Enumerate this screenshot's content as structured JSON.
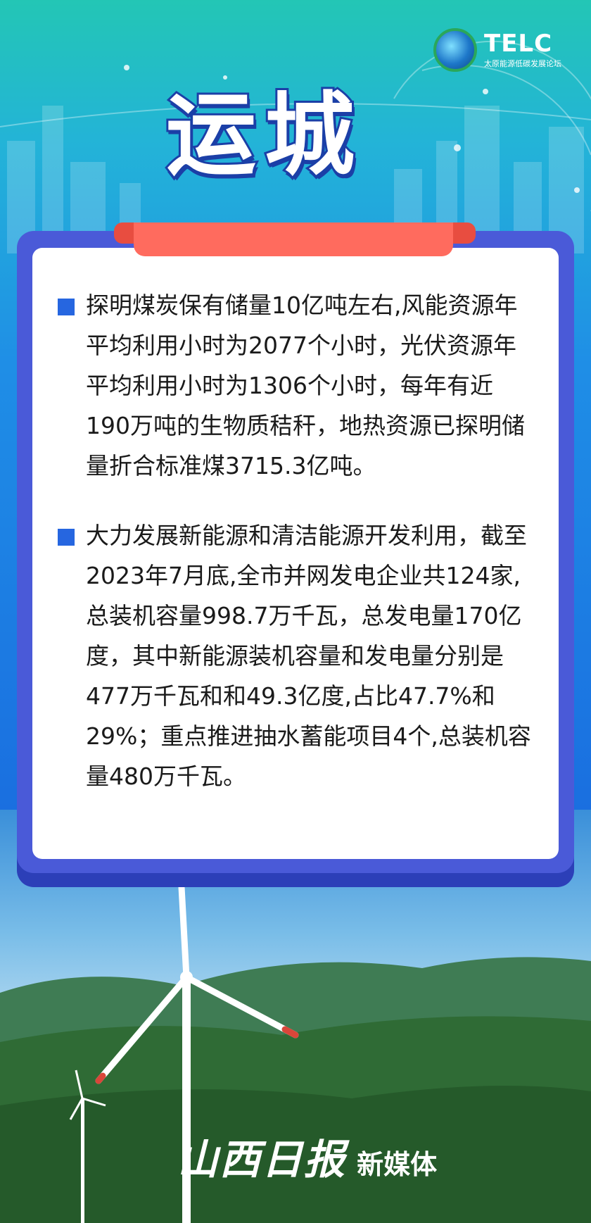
{
  "logo": {
    "name": "TELC",
    "subtitle": "太原能源低碳发展论坛"
  },
  "city_title": "运城",
  "paragraphs": [
    "探明煤炭保有储量10亿吨左右,风能资源年平均利用小时为2077个小时，光伏资源年平均利用小时为1306个小时，每年有近190万吨的生物质秸秆，地热资源已探明储量折合标准煤3715.3亿吨。",
    "大力发展新能源和清洁能源开发利用，截至2023年7月底,全市并网发电企业共124家,总装机容量998.7万千瓦，总发电量170亿度，其中新能源装机容量和发电量分别是477万千瓦和和49.3亿度,占比47.7%和29%；重点推进抽水蓄能项目4个,总装机容量480万千瓦。"
  ],
  "brand": {
    "script": "山西日报",
    "tail": "新媒体"
  },
  "colors": {
    "accent_blue": "#2666e0",
    "frame_blue": "#4a5ad8",
    "tab_red": "#ff6b5e",
    "title_stroke": "#1b3fa7"
  }
}
